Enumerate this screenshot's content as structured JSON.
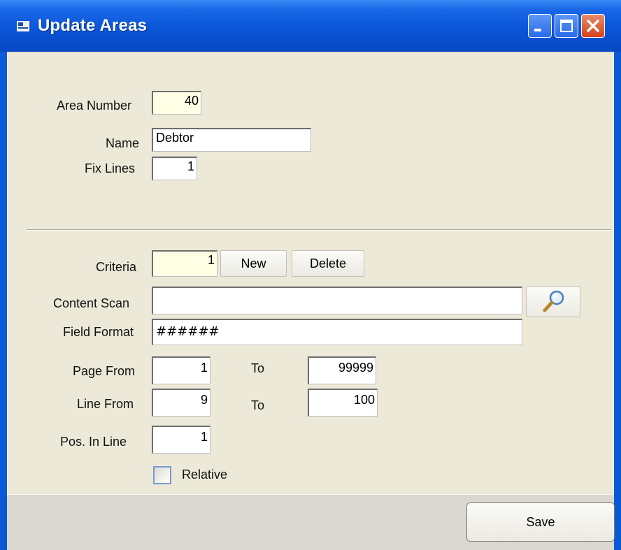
{
  "window": {
    "title": "Update Areas"
  },
  "form": {
    "area_number": {
      "label": "Area Number",
      "value": "40"
    },
    "name": {
      "label": "Name",
      "value": "Debtor"
    },
    "fix_lines": {
      "label": "Fix Lines",
      "value": "1"
    },
    "criteria": {
      "label": "Criteria",
      "value": "1",
      "new_label": "New",
      "delete_label": "Delete"
    },
    "content_scan": {
      "label": "Content Scan",
      "value": ""
    },
    "field_format": {
      "label": "Field Format",
      "value": "######"
    },
    "page_from": {
      "label": "Page From",
      "value": "1",
      "to_label": "To",
      "to_value": "99999"
    },
    "line_from": {
      "label": "Line From",
      "value": "9",
      "to_label": "To",
      "to_value": "100"
    },
    "pos_in_line": {
      "label": "Pos. In Line",
      "value": "1"
    },
    "relative": {
      "label": "Relative",
      "checked": false
    }
  },
  "footer": {
    "save_label": "Save"
  },
  "icons": {
    "title": "form-icon",
    "minimize": "minimize-icon",
    "maximize": "maximize-icon",
    "close": "close-icon",
    "search": "magnifier-icon"
  },
  "colors": {
    "titlebar": "#0a55d8",
    "highlight_field": "#ffffe6",
    "close_button": "#d6431c"
  }
}
